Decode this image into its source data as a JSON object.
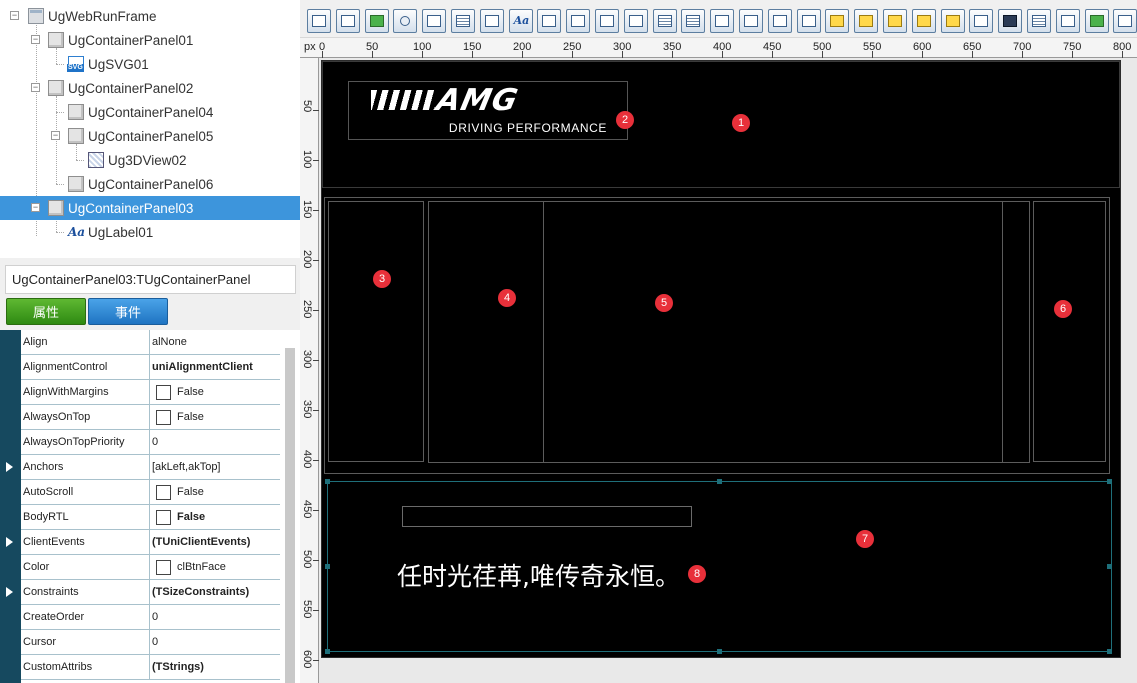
{
  "tree": {
    "nodes": [
      {
        "label": "UgWebRunFrame",
        "icon": "frame-icon",
        "selected": false
      },
      {
        "label": "UgContainerPanel01",
        "icon": "panel-icon",
        "selected": false
      },
      {
        "label": "UgSVG01",
        "icon": "svg-icon",
        "selected": false
      },
      {
        "label": "UgContainerPanel02",
        "icon": "panel-icon",
        "selected": false
      },
      {
        "label": "UgContainerPanel04",
        "icon": "panel-icon",
        "selected": false
      },
      {
        "label": "UgContainerPanel05",
        "icon": "panel-icon",
        "selected": false
      },
      {
        "label": "Ug3DView02",
        "icon": "3d-view-icon",
        "selected": false
      },
      {
        "label": "UgContainerPanel06",
        "icon": "panel-icon",
        "selected": false
      },
      {
        "label": "UgContainerPanel03",
        "icon": "panel-icon",
        "selected": true
      },
      {
        "label": "UgLabel01",
        "icon": "label-icon",
        "selected": false
      }
    ]
  },
  "inspector": {
    "class_name": "UgContainerPanel03:TUgContainerPanel",
    "tab_properties": "属性",
    "tab_events": "事件",
    "properties": [
      {
        "name": "Align",
        "value": "alNone",
        "checkbox": false,
        "bold": false,
        "expandable": false
      },
      {
        "name": "AlignmentControl",
        "value": "uniAlignmentClient",
        "checkbox": false,
        "bold": true,
        "expandable": false
      },
      {
        "name": "AlignWithMargins",
        "value": "False",
        "checkbox": true,
        "bold": false,
        "expandable": false
      },
      {
        "name": "AlwaysOnTop",
        "value": "False",
        "checkbox": true,
        "bold": false,
        "expandable": false
      },
      {
        "name": "AlwaysOnTopPriority",
        "value": "0",
        "checkbox": false,
        "bold": false,
        "expandable": false
      },
      {
        "name": "Anchors",
        "value": "[akLeft,akTop]",
        "checkbox": false,
        "bold": false,
        "expandable": true
      },
      {
        "name": "AutoScroll",
        "value": "False",
        "checkbox": true,
        "bold": false,
        "expandable": false
      },
      {
        "name": "BodyRTL",
        "value": "False",
        "checkbox": true,
        "bold": true,
        "expandable": false
      },
      {
        "name": "ClientEvents",
        "value": "(TUniClientEvents)",
        "checkbox": false,
        "bold": true,
        "expandable": true
      },
      {
        "name": "Color",
        "value": "clBtnFace",
        "checkbox": true,
        "bold": false,
        "expandable": false
      },
      {
        "name": "Constraints",
        "value": "(TSizeConstraints)",
        "checkbox": false,
        "bold": true,
        "expandable": true
      },
      {
        "name": "CreateOrder",
        "value": "0",
        "checkbox": false,
        "bold": false,
        "expandable": false
      },
      {
        "name": "Cursor",
        "value": "0",
        "checkbox": false,
        "bold": false,
        "expandable": false
      },
      {
        "name": "CustomAttribs",
        "value": "(TStrings)",
        "checkbox": false,
        "bold": true,
        "expandable": false
      }
    ]
  },
  "toolbar": {
    "buttons": [
      "form-icon",
      "button-icon",
      "panel-icon",
      "radio-icon",
      "checkbox-icon",
      "listbox-icon",
      "grid-icon",
      "label-icon",
      "edit-icon",
      "combobox-icon",
      "spin-edit-icon",
      "date-icon",
      "memo-icon",
      "list-icon",
      "tabs-icon",
      "pagecontrol-icon",
      "image-icon",
      "container-icon",
      "folder-icon",
      "folder-icon",
      "folder-icon",
      "folder-icon",
      "folder-icon",
      "window-icon",
      "dark-panel-icon",
      "document-icon",
      "video-icon",
      "chart-icon",
      "picture-icon"
    ]
  },
  "ruler": {
    "unit": "px",
    "h_labels": [
      "0",
      "50",
      "100",
      "150",
      "200",
      "250",
      "300",
      "350",
      "400",
      "450",
      "500",
      "550",
      "600",
      "650",
      "700",
      "750",
      "800"
    ],
    "v_labels": [
      "50",
      "100",
      "150",
      "200",
      "250",
      "300",
      "350",
      "400",
      "450",
      "500",
      "550",
      "600"
    ]
  },
  "design": {
    "logo_brand": "AMG",
    "logo_tagline": "DRIVING PERFORMANCE",
    "slogan": "任时光荏苒,唯传奇永恒。",
    "badges": [
      "1",
      "2",
      "3",
      "4",
      "5",
      "6",
      "7",
      "8"
    ]
  },
  "colors": {
    "selection": "#3d95dc",
    "canvas": "#000000",
    "badge": "#e8303a",
    "props_tab": "#2e8a12",
    "events_tab": "#1f74c2",
    "grid_gutter": "#16495f"
  }
}
